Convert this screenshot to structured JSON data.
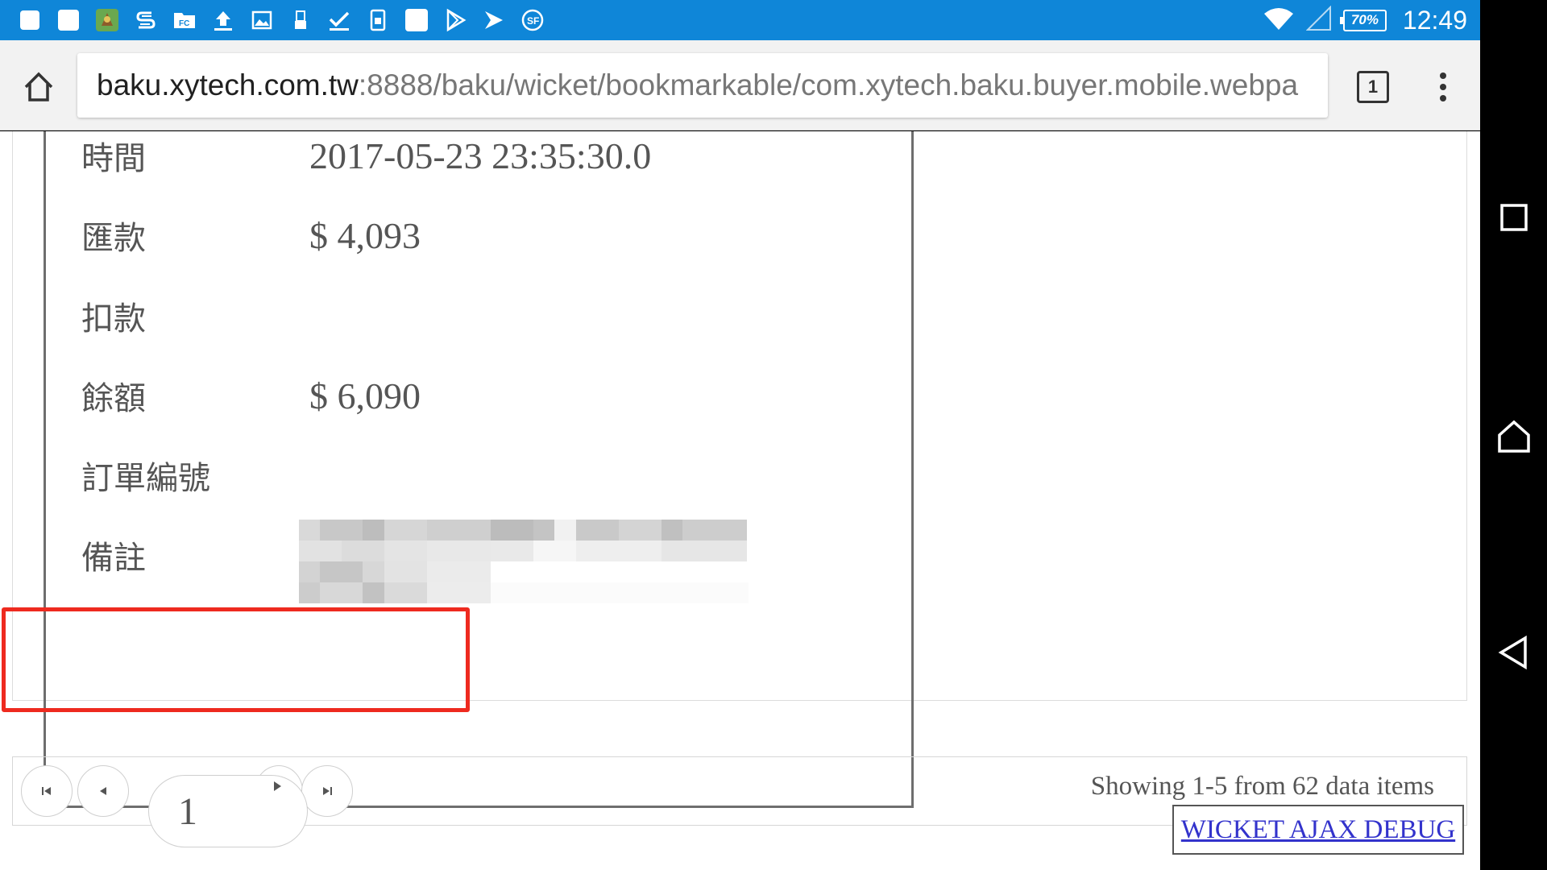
{
  "status_bar": {
    "notification_icons": [
      "app-icon",
      "app-icon",
      "game-icon",
      "s-icon",
      "fc-icon",
      "upload-icon",
      "image-icon",
      "usb-icon",
      "check-icon",
      "sim-icon",
      "app-icon",
      "play-store-icon",
      "play-icon",
      "sf-icon"
    ],
    "battery_level": "70%",
    "time": "12:49",
    "color": "#0f86d8"
  },
  "browser": {
    "url_host": "baku.xytech.com.tw",
    "url_path": ":8888/baku/wicket/bookmarkable/com.xytech.baku.buyer.mobile.webpa",
    "tab_count": "1"
  },
  "record": {
    "time_label": "時間",
    "time_value": "2017-05-23 23:35:30.0",
    "remit_label": "匯款",
    "remit_value": "$ 4,093",
    "deduct_label": "扣款",
    "deduct_value": "",
    "balance_label": "餘額",
    "balance_value": "$ 6,090",
    "order_label": "訂單編號",
    "order_value": "",
    "note_label": "備註"
  },
  "pagination": {
    "current_page": "1",
    "summary": "Showing 1-5 from 62 data items"
  },
  "debug_link": "WICKET AJAX DEBUG",
  "highlight_color": "#ee2a1f"
}
